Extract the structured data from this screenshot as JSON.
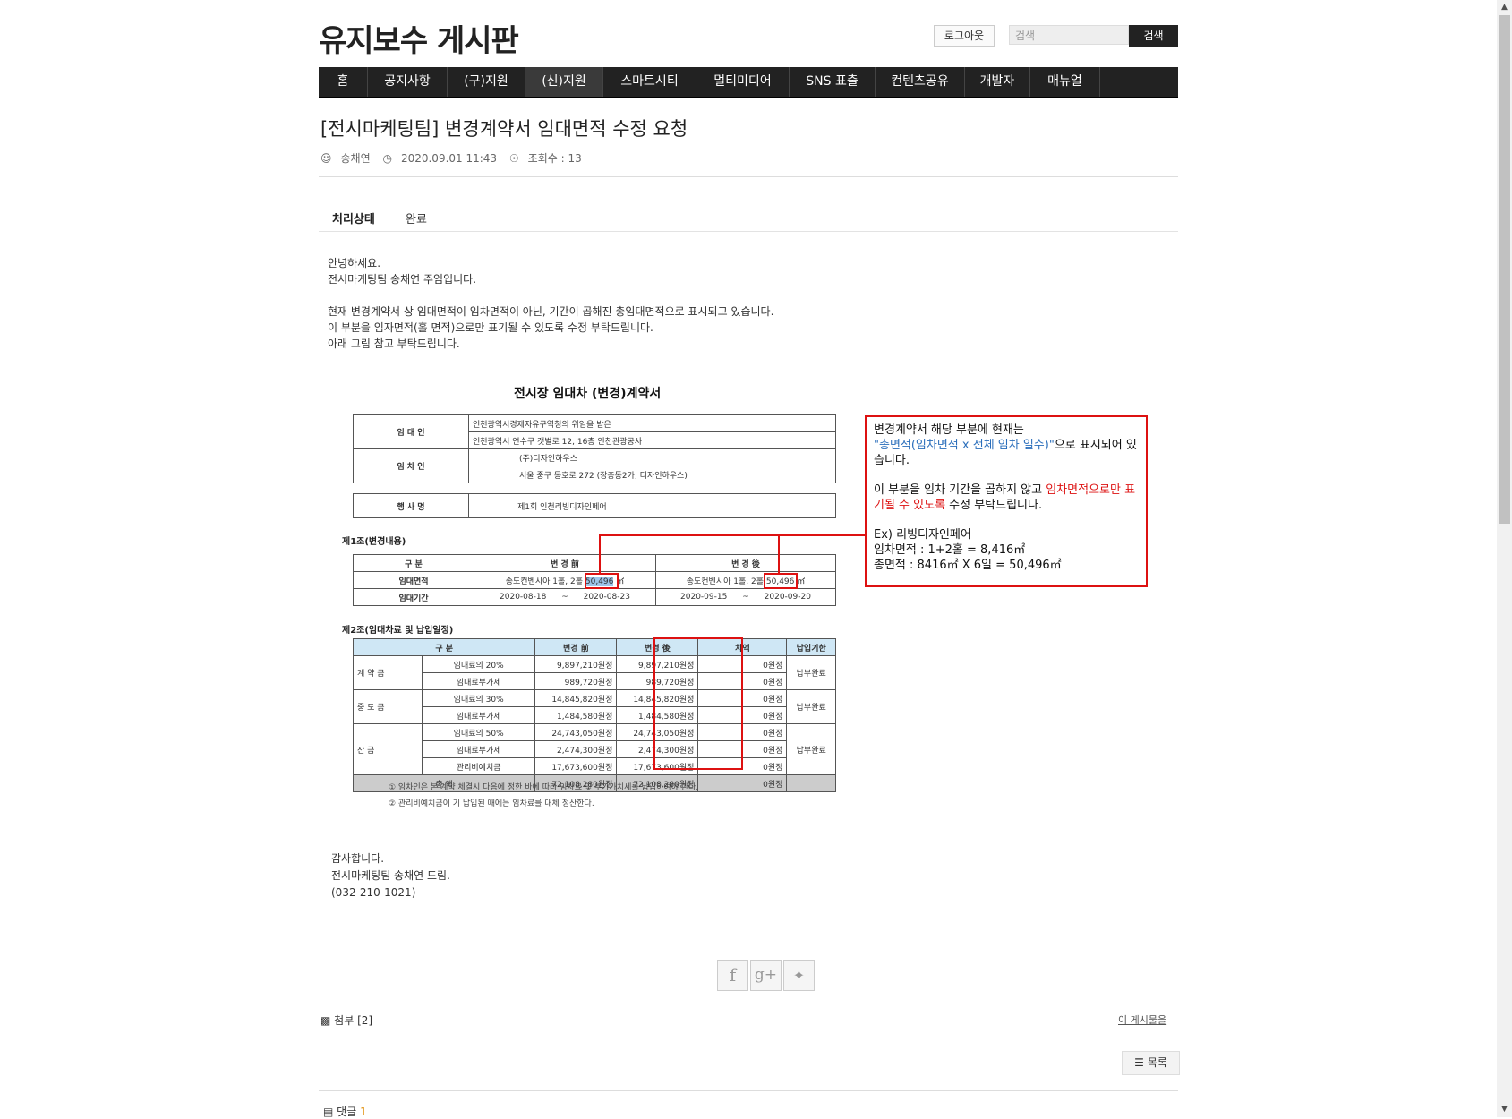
{
  "site": {
    "title": "유지보수 게시판",
    "logout": "로그아웃",
    "search_placeholder": "검색",
    "search_button": "검색"
  },
  "nav": [
    "홈",
    "공지사항",
    "(구)지원",
    "(신)지원",
    "스마트시티",
    "멀티미디어",
    "SNS 표출",
    "컨텐츠공유",
    "개발자",
    "매뉴얼"
  ],
  "post": {
    "title": "[전시마케팅팀] 변경계약서 임대면적 수정 요청",
    "author": "송채연",
    "date": "2020.09.01 11:43",
    "views": "조회수 : 13",
    "status_label": "처리상태",
    "status_value": "완료",
    "body": "안녕하세요.\n전시마케팅팀 송채연 주임입니다.\n\n현재 변경계약서 상 임대면적이 임차면적이 아닌, 기간이 곱해진 총임대면적으로 표시되고 있습니다.\n이 부분을 임자면적(홀 면적)으로만 표기될 수 있도록 수정 부탁드립니다.\n아래 그림 참고 부탁드립니다.",
    "closing": "감사합니다.\n전시마케팅팀 송채연 드림.\n(032-210-1021)"
  },
  "doc": {
    "title": "전시장 임대차 (변경)계약서",
    "lessor_label": "임 대 인",
    "lessor_1": "인천광역시경제자유구역청의 위임을 받은",
    "lessor_2": "인천광역시 연수구 갯벌로 12, 16층 인천관광공사",
    "lessee_label": "임 차 인",
    "lessee_1": "(주)디자인하우스",
    "lessee_2": "서울 중구 동호로 272 (장충동2가, 디자인하우스)",
    "event_label": "행 사 명",
    "event_value": "제1회 인천리빙디자인페어",
    "art1": "제1조(변경내용)",
    "art1_head": [
      "구 분",
      "변 경 前",
      "변 경 後"
    ],
    "area_label": "임대면적",
    "area_before": "송도컨벤시아 1홀, 2홀",
    "area_before_val": "50,496",
    "area_after": "송도컨벤시아 1홀, 2홀",
    "area_after_val": "50,496",
    "unit": "㎡",
    "period_label": "임대기간",
    "period_before": [
      "2020-08-18",
      "~",
      "2020-08-23"
    ],
    "period_after": [
      "2020-09-15",
      "~",
      "2020-09-20"
    ],
    "art2": "제2조(임대차료 및 납입일정)",
    "art2_head": [
      "구 분",
      "변경 前",
      "변경 後",
      "차액",
      "납입기한"
    ],
    "groups": [
      {
        "name": "계  약  금",
        "due": "납부완료",
        "rows": [
          [
            "임대료의 20%",
            "9,897,210원정",
            "9,897,210원정",
            "0원정"
          ],
          [
            "임대료부가세",
            "989,720원정",
            "989,720원정",
            "0원정"
          ]
        ]
      },
      {
        "name": "중  도  금",
        "due": "납부완료",
        "rows": [
          [
            "임대료의 30%",
            "14,845,820원정",
            "14,845,820원정",
            "0원정"
          ],
          [
            "임대료부가세",
            "1,484,580원정",
            "1,484,580원정",
            "0원정"
          ]
        ]
      },
      {
        "name": "잔      금",
        "due": "납부완료",
        "rows": [
          [
            "임대료의 50%",
            "24,743,050원정",
            "24,743,050원정",
            "0원정"
          ],
          [
            "임대료부가세",
            "2,474,300원정",
            "2,474,300원정",
            "0원정"
          ],
          [
            "관리비예치금",
            "17,673,600원정",
            "17,673,600원정",
            "0원정"
          ]
        ]
      }
    ],
    "total": [
      "총  액",
      "72,108,280원정",
      "72,108,280원정",
      "0원정"
    ],
    "fn1": "① 임차인은 본 계약 체결시 다음에 정한 바에 따라 임차료 및 부가가치세를 납입하여야 한다.",
    "fn2": "② 관리비예치금이 기 납입된 때에는 임차료를 대체 정산한다."
  },
  "note": {
    "l1": "변경계약서 해당 부분에 현재는",
    "l2_blue": "\"총면적(임차면적 x 전체 임차 일수)\"",
    "l2_rest": "으로 표시되어 있습니다.",
    "l3a": "이 부분을 임차 기간을 곱하지 않고 ",
    "l3_red": "임차면적으로만 표기될 수 있도록",
    "l3b": " 수정 부탁드립니다.",
    "ex": "Ex) 리빙디자인페어",
    "ex2": "임차면적 : 1+2홀 = 8,416㎡",
    "ex3": "총면적 : 8416㎡ X 6일 = 50,496㎡"
  },
  "footer": {
    "attach": "첨부 [2]",
    "this_post": "이 게시물을",
    "list": "목록",
    "comment": "댓글",
    "comment_count": "1"
  },
  "icons": [
    "user-icon",
    "clock-icon",
    "eye-icon",
    "facebook-icon",
    "google-plus-icon",
    "twitter-icon",
    "attach-icon",
    "list-icon",
    "comment-icon"
  ],
  "colors": {
    "accent_red": "#d11111",
    "note_blue": "#2a6ebb",
    "nav_bg": "#222222",
    "comment_count": "#e08a00"
  }
}
